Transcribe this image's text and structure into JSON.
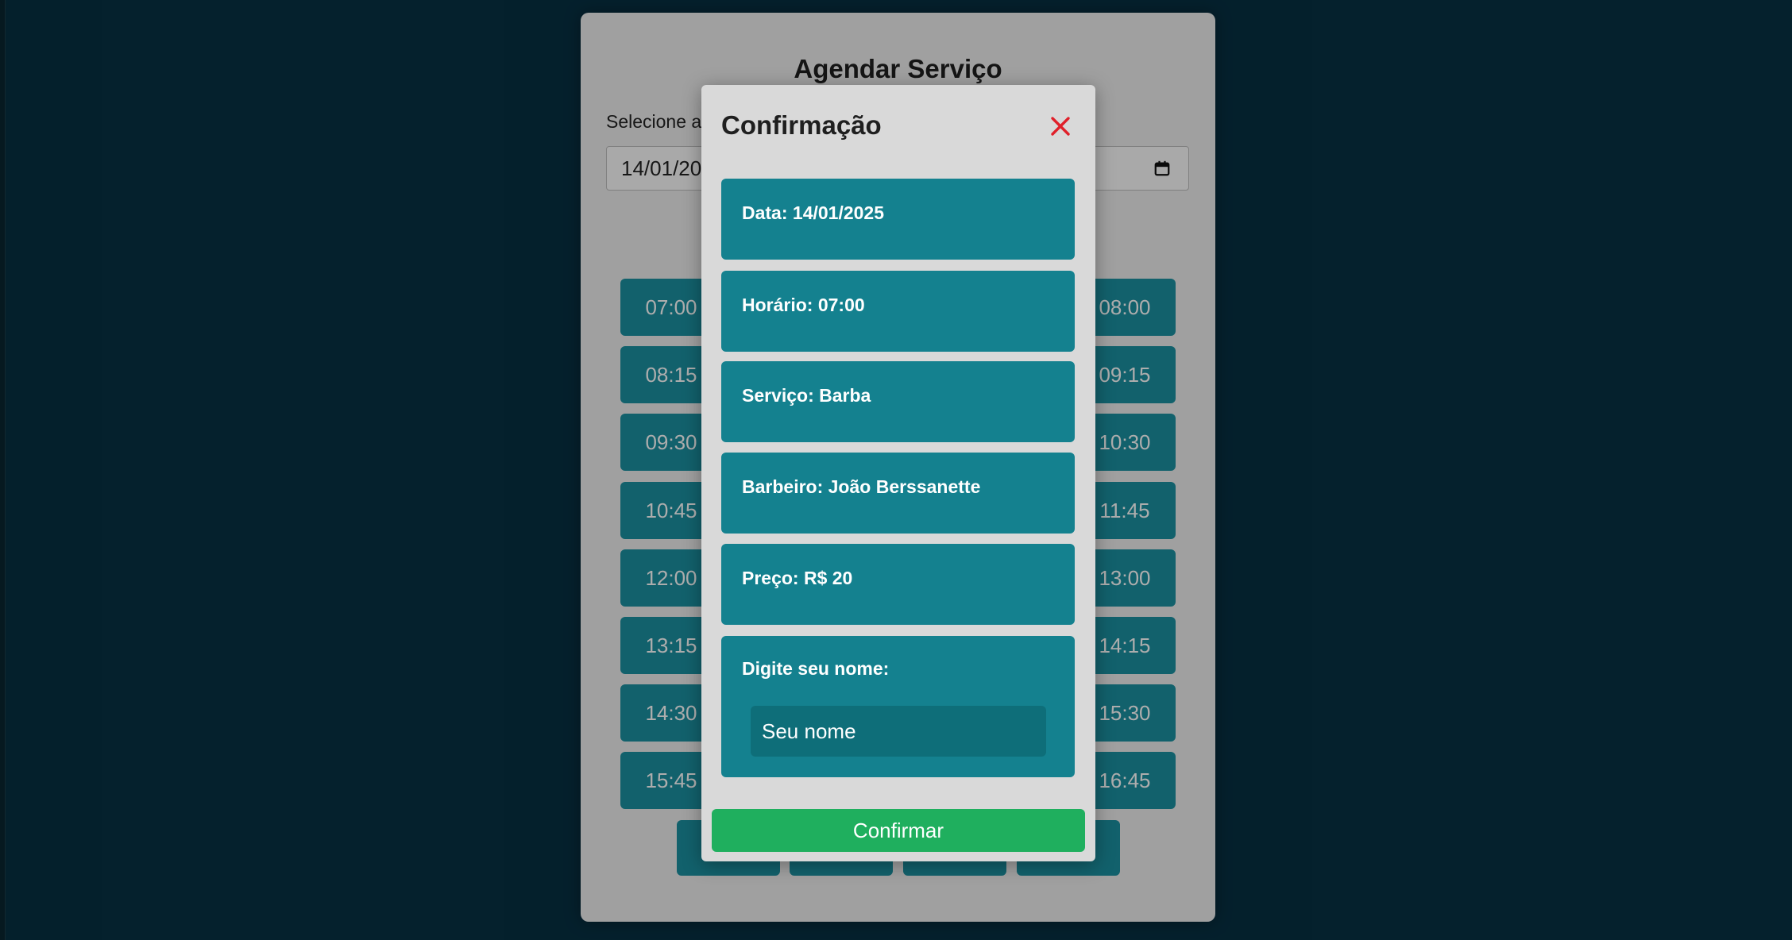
{
  "page": {
    "title": "Agendar Serviço",
    "date_label": "Selecione a data:",
    "date_value": "14/01/2025"
  },
  "slots": {
    "left": [
      "07:00",
      "08:15",
      "09:30",
      "10:45",
      "12:00",
      "13:15",
      "14:30",
      "15:45"
    ],
    "right": [
      "08:00",
      "09:15",
      "10:30",
      "11:45",
      "13:00",
      "14:15",
      "15:30",
      "16:45"
    ]
  },
  "modal": {
    "title": "Confirmação",
    "data_text": "Data: 14/01/2025",
    "horario_text": "Horário: 07:00",
    "servico_text": "Serviço: Barba",
    "barbeiro_text": "Barbeiro: João Berssanette",
    "preco_text": "Preço: R$ 20",
    "name_label": "Digite seu nome:",
    "name_placeholder": "Seu nome",
    "name_value": "",
    "confirm_label": "Confirmar"
  },
  "colors": {
    "background": "#073042",
    "info_box": "#14818f",
    "slot_button": "#1b8f9f",
    "confirm_button": "#1faf5e",
    "close_icon": "#e0202a"
  },
  "icons": {
    "close": "close-icon",
    "calendar": "calendar-icon"
  }
}
